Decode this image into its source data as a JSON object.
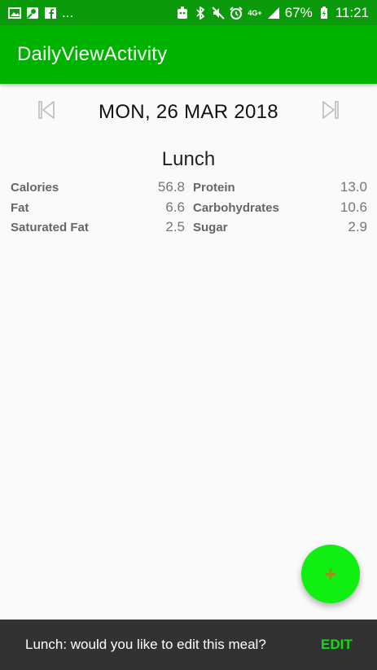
{
  "status_bar": {
    "left_overflow": "...",
    "network": "4G+",
    "battery_percent": "67%",
    "time": "11:21"
  },
  "app_bar": {
    "title": "DailyViewActivity"
  },
  "date_nav": {
    "date": "MON, 26 MAR 2018",
    "prev_icon": "skip-previous-icon",
    "next_icon": "skip-next-icon"
  },
  "meal": {
    "title": "Lunch",
    "left_column": [
      {
        "label": "Calories",
        "value": "56.8"
      },
      {
        "label": "Fat",
        "value": "6.6"
      },
      {
        "label": "Saturated Fat",
        "value": "2.5"
      }
    ],
    "right_column": [
      {
        "label": "Protein",
        "value": "13.0"
      },
      {
        "label": "Carbohydrates",
        "value": "10.6"
      },
      {
        "label": "Sugar",
        "value": "2.9"
      }
    ]
  },
  "fab": {
    "icon": "plus-icon",
    "glyph": "+"
  },
  "snackbar": {
    "message": "Lunch: would you like to edit this meal?",
    "action": "EDIT"
  },
  "colors": {
    "status_bar": "#0b9a0b",
    "app_bar": "#00b200",
    "fab": "#11ee11",
    "snackbar_bg": "#323232",
    "snackbar_action": "#16d816"
  }
}
